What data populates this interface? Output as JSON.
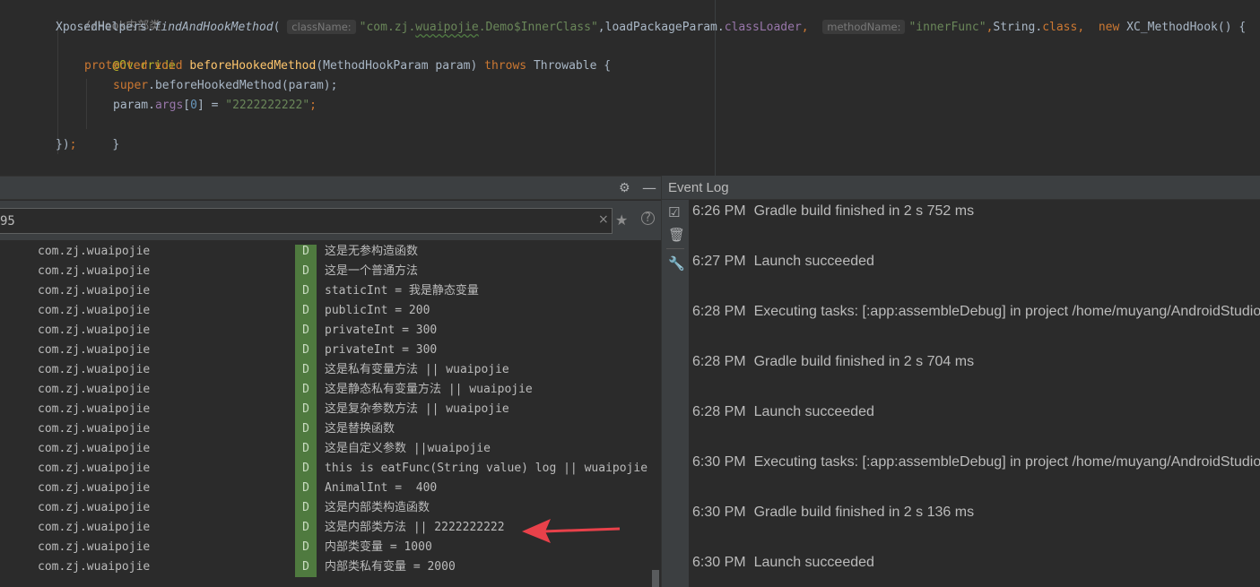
{
  "editor": {
    "comment": "//Hook内部类",
    "line1": {
      "cls": "XposedHelpers",
      "dot": ".",
      "method": "findAndHookMethod",
      "paren": "(",
      "hint1": "className:",
      "str_prefix": "\"com.zj.",
      "str_squiggle": "wuaipojie",
      "str_suffix": ".Demo$InnerClass\"",
      "comma1": ",",
      "lpp": "loadPackageParam",
      "dot2": ".",
      "classLoader": "classLoader",
      "comma2": ",",
      "hint2": "methodName:",
      "str2": "\"innerFunc\"",
      "comma3": ",",
      "string_cls": "String",
      "dot3": ".",
      "class_kw": "class",
      "comma4": ",",
      "new_kw": "new",
      "hook_cls": "XC_MethodHook",
      "tail": "() {"
    },
    "annotation": "@Override",
    "line3": {
      "protected": "protected",
      "void": "void",
      "fn": "beforeHookedMethod",
      "params": "(MethodHookParam param)",
      "throws": "throws",
      "throwable": "Throwable {"
    },
    "line4": {
      "super": "super",
      "rest": ".beforeHookedMethod(param);"
    },
    "line5": {
      "param": "param.",
      "args": "args",
      "open": "[",
      "idx": "0",
      "close": "] = ",
      "val": "\"2222222222\"",
      "semi": ";"
    },
    "line6": "}",
    "line7": {
      "close": "})",
      "semi": ";"
    }
  },
  "logcat": {
    "filter_value": "95",
    "clear_icon": "close-icon",
    "log_level": "D",
    "rows": [
      {
        "pkg": "com.zj.wuaipojie",
        "level": "D",
        "msg": "这是无参构造函数"
      },
      {
        "pkg": "com.zj.wuaipojie",
        "level": "D",
        "msg": "这是一个普通方法"
      },
      {
        "pkg": "com.zj.wuaipojie",
        "level": "D",
        "msg": "staticInt = 我是静态变量"
      },
      {
        "pkg": "com.zj.wuaipojie",
        "level": "D",
        "msg": "publicInt = 200"
      },
      {
        "pkg": "com.zj.wuaipojie",
        "level": "D",
        "msg": "privateInt = 300"
      },
      {
        "pkg": "com.zj.wuaipojie",
        "level": "D",
        "msg": "privateInt = 300"
      },
      {
        "pkg": "com.zj.wuaipojie",
        "level": "D",
        "msg": "这是私有变量方法 || wuaipojie"
      },
      {
        "pkg": "com.zj.wuaipojie",
        "level": "D",
        "msg": "这是静态私有变量方法 || wuaipojie"
      },
      {
        "pkg": "com.zj.wuaipojie",
        "level": "D",
        "msg": "这是复杂参数方法 || wuaipojie"
      },
      {
        "pkg": "com.zj.wuaipojie",
        "level": "D",
        "msg": "这是替换函数"
      },
      {
        "pkg": "com.zj.wuaipojie",
        "level": "D",
        "msg": "这是自定义参数 ||wuaipojie"
      },
      {
        "pkg": "com.zj.wuaipojie",
        "level": "D",
        "msg": "this is eatFunc(String value) log || wuaipojie"
      },
      {
        "pkg": "com.zj.wuaipojie",
        "level": "D",
        "msg": "AnimalInt =  400"
      },
      {
        "pkg": "com.zj.wuaipojie",
        "level": "D",
        "msg": "这是内部类构造函数"
      },
      {
        "pkg": "com.zj.wuaipojie",
        "level": "D",
        "msg": "这是内部类方法 || 2222222222"
      },
      {
        "pkg": "com.zj.wuaipojie",
        "level": "D",
        "msg": "内部类变量 = 1000"
      },
      {
        "pkg": "com.zj.wuaipojie",
        "level": "D",
        "msg": "内部类私有变量 = 2000"
      }
    ]
  },
  "eventlog": {
    "title": "Event Log",
    "events": [
      {
        "time": "6:26 PM",
        "text": "Gradle build finished in 2 s 752 ms"
      },
      {
        "time": "6:27 PM",
        "text": "Launch succeeded"
      },
      {
        "time": "6:28 PM",
        "text": "Executing tasks: [:app:assembleDebug] in project /home/muyang/AndroidStudioPro"
      },
      {
        "time": "6:28 PM",
        "text": "Gradle build finished in 2 s 704 ms"
      },
      {
        "time": "6:28 PM",
        "text": "Launch succeeded"
      },
      {
        "time": "6:30 PM",
        "text": "Executing tasks: [:app:assembleDebug] in project /home/muyang/AndroidStudioPro"
      },
      {
        "time": "6:30 PM",
        "text": "Gradle build finished in 2 s 136 ms"
      },
      {
        "time": "6:30 PM",
        "text": "Launch succeeded"
      }
    ]
  },
  "colors": {
    "background": "#2b2b2b",
    "panel_header": "#3c3f41",
    "debug_level": "#4f7a3f",
    "annotation_arrow": "#e8414a"
  }
}
